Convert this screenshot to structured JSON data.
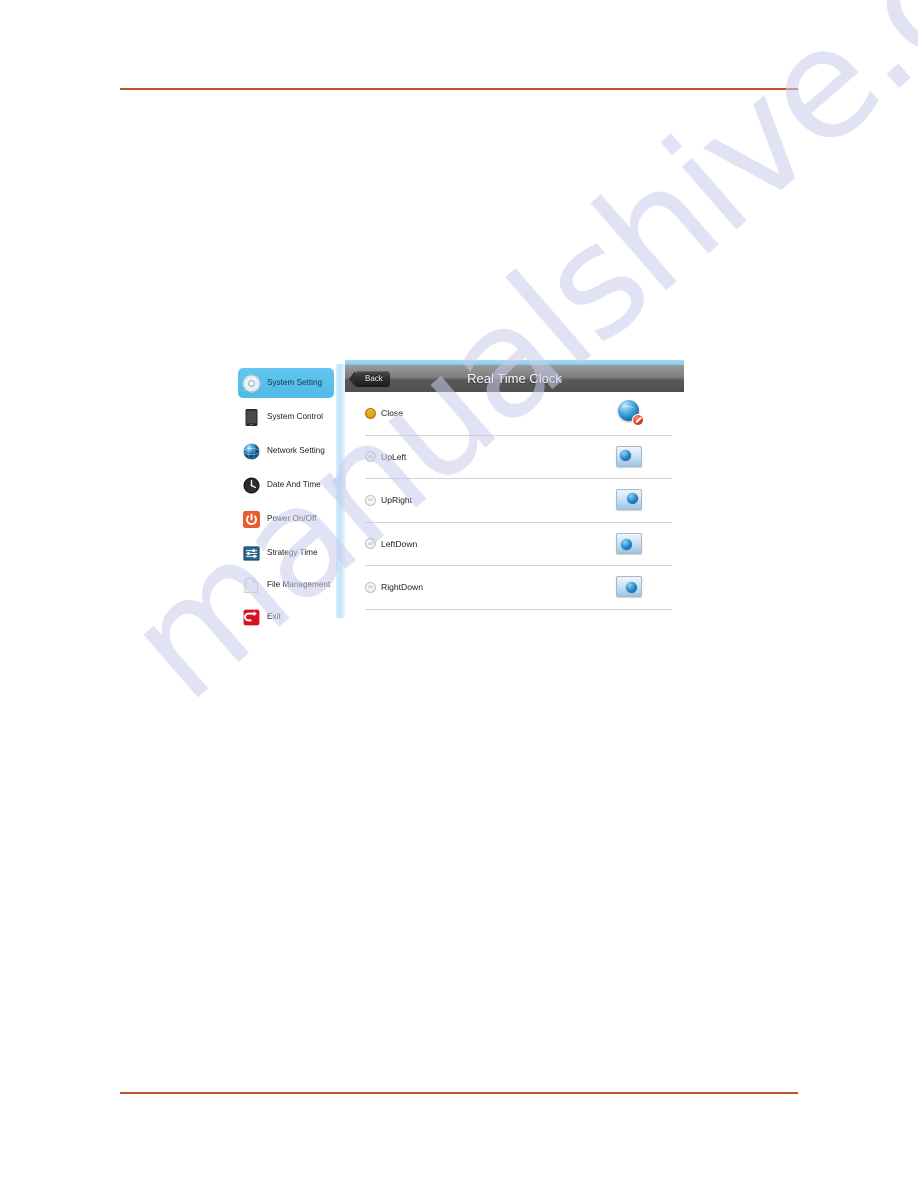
{
  "page": {
    "rules_color": "#c0552c",
    "watermark_text": "manualshive.com"
  },
  "device_ui": {
    "sidebar": {
      "items": [
        {
          "label": "System Setting",
          "icon": "gear-icon",
          "selected": true
        },
        {
          "label": "System Control",
          "icon": "tablet-icon",
          "selected": false
        },
        {
          "label": "Network Setting",
          "icon": "globe-icon",
          "selected": false
        },
        {
          "label": "Date And Time",
          "icon": "clock-icon",
          "selected": false
        },
        {
          "label": "Power On/Off",
          "icon": "power-icon",
          "selected": false
        },
        {
          "label": "Strategy Time",
          "icon": "strategy-icon",
          "selected": false
        },
        {
          "label": "File Management",
          "icon": "file-icon",
          "selected": false
        },
        {
          "label": "Exit",
          "icon": "exit-icon",
          "selected": false
        }
      ],
      "selected_bg": "#55bfec"
    },
    "panel": {
      "back_label": "Back",
      "title": "Real Time Clock",
      "header_bg": "#6e6e6e",
      "rows": [
        {
          "label": "Close",
          "selected": true,
          "icon": "globe-blocked-icon"
        },
        {
          "label": "UpLeft",
          "selected": false,
          "icon": "monitor-globe-upleft-icon"
        },
        {
          "label": "UpRight",
          "selected": false,
          "icon": "monitor-globe-upright-icon"
        },
        {
          "label": "LeftDown",
          "selected": false,
          "icon": "monitor-globe-leftdown-icon"
        },
        {
          "label": "RightDown",
          "selected": false,
          "icon": "monitor-globe-rightdown-icon"
        }
      ],
      "radio_selected_color": "#f59a14"
    }
  }
}
